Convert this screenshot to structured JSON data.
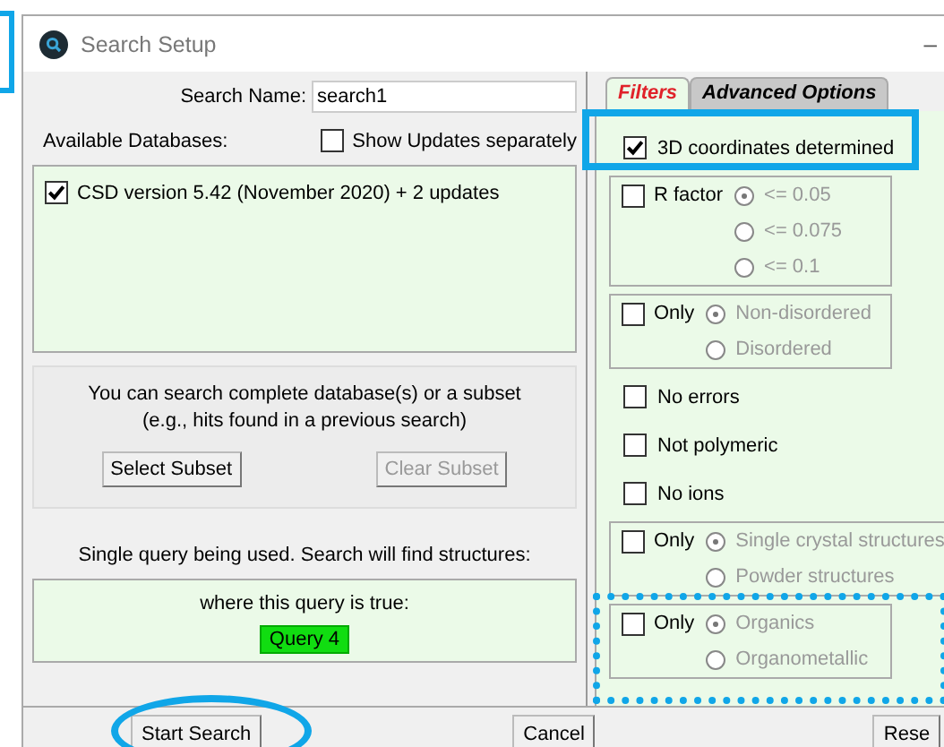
{
  "window": {
    "title": "Search Setup",
    "control": "–"
  },
  "search_name": {
    "label": "Search Name:",
    "value": "search1"
  },
  "databases": {
    "label": "Available Databases:",
    "show_updates": {
      "label": "Show Updates separately",
      "checked": false
    },
    "items": [
      {
        "label": "CSD version 5.42 (November 2020) + 2 updates",
        "checked": true
      }
    ]
  },
  "subset": {
    "text": "You can search complete database(s) or a subset",
    "text2": "(e.g., hits found in a previous search)",
    "buttons": [
      {
        "label": "Select Subset",
        "disabled": false
      },
      {
        "label": "Clear Subset",
        "disabled": true
      }
    ]
  },
  "query": {
    "caption": "Single query being used. Search will find structures:",
    "text": "where this query is true:",
    "badge": "Query 4"
  },
  "tabs": [
    {
      "label": "Filters",
      "selected": true
    },
    {
      "label": "Advanced Options",
      "selected": false
    }
  ],
  "filters": [
    {
      "kind": "check",
      "label": "3D coordinates determined",
      "checked": true
    },
    {
      "kind": "group",
      "label": "R factor",
      "checked": false,
      "options": [
        {
          "label": "<= 0.05",
          "selected": true
        },
        {
          "label": "<= 0.075",
          "selected": false
        },
        {
          "label": "<= 0.1",
          "selected": false
        }
      ]
    },
    {
      "kind": "group",
      "label": "Only",
      "checked": false,
      "options": [
        {
          "label": "Non-disordered",
          "selected": true
        },
        {
          "label": "Disordered",
          "selected": false
        }
      ]
    },
    {
      "kind": "check",
      "label": "No errors",
      "checked": false
    },
    {
      "kind": "check",
      "label": "Not polymeric",
      "checked": false
    },
    {
      "kind": "check",
      "label": "No ions",
      "checked": false
    },
    {
      "kind": "group",
      "label": "Only",
      "checked": false,
      "options": [
        {
          "label": "Single crystal structures",
          "selected": true
        },
        {
          "label": "Powder structures",
          "selected": false
        }
      ]
    },
    {
      "kind": "group",
      "label": "Only",
      "checked": false,
      "options": [
        {
          "label": "Organics",
          "selected": true
        },
        {
          "label": "Organometallic",
          "selected": false
        }
      ]
    }
  ],
  "footer": [
    {
      "label": "Start Search"
    },
    {
      "label": "Cancel"
    },
    {
      "label": "Rese"
    }
  ]
}
